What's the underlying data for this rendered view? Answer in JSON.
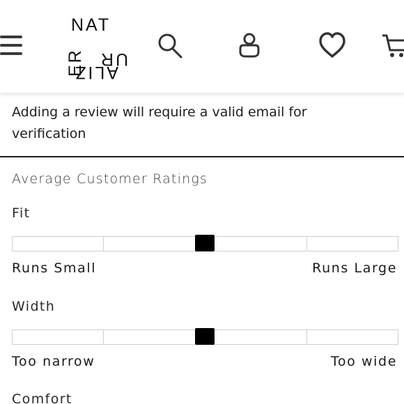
{
  "header": {
    "logo": {
      "top": "NAT",
      "left_col": "ER",
      "right_col": "UR",
      "bottom": "ALIZ"
    },
    "icons": [
      "menu-icon",
      "search-icon",
      "account-icon",
      "heart-icon",
      "cart-icon"
    ]
  },
  "notice": {
    "text": "Adding a review will require a valid email for verification"
  },
  "ratings": {
    "title": "Average Customer Ratings",
    "fit": {
      "label": "Fit",
      "min_label": "Runs Small",
      "max_label": "Runs Large",
      "position": 0.5
    },
    "width": {
      "label": "Width",
      "min_label": "Too narrow",
      "max_label": "Too wide",
      "position": 0.5
    },
    "comfort": {
      "label": "Comfort"
    }
  },
  "colors": {
    "marker": "#000000",
    "segment_border": "#cfcfcf",
    "divider": "#1a1a1a"
  }
}
